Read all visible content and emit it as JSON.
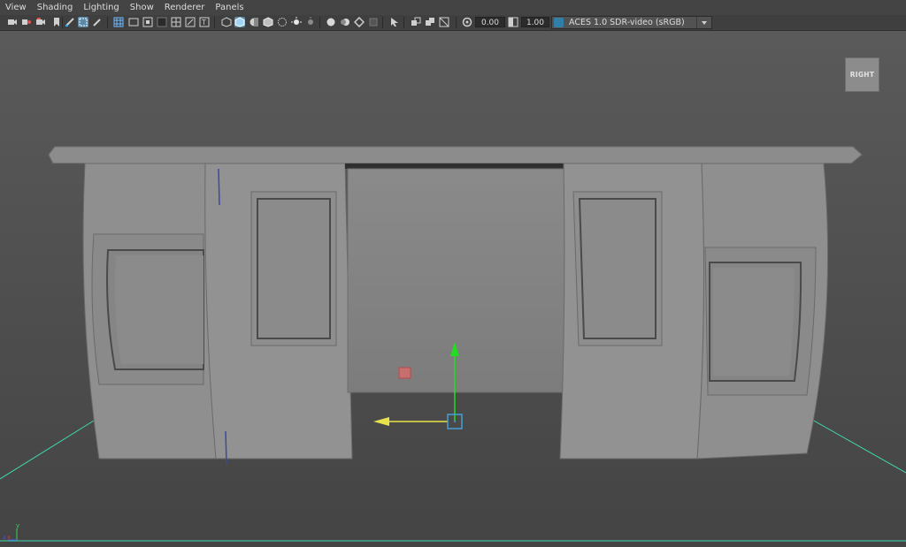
{
  "menu": [
    "View",
    "Shading",
    "Lighting",
    "Show",
    "Renderer",
    "Panels"
  ],
  "toolbar": {
    "exposure_value": "0.00",
    "gamma_value": "1.00",
    "color_management_label": "ACES 1.0 SDR-video (sRGB)"
  },
  "viewport": {
    "view_label": "RIGHT",
    "axis": {
      "x": "x",
      "y": "y",
      "z": "z"
    }
  },
  "icons": [
    "camera-select-icon",
    "camera-attributes-icon",
    "bookmark-icon",
    "image-plane-icon",
    "grease-pencil-icon",
    "2d-pan-zoom-icon",
    "grid-icon",
    "film-gate-icon",
    "resolution-gate-icon",
    "gate-mask-icon",
    "field-chart-icon",
    "safe-action-icon",
    "safe-title-icon",
    "wireframe-icon",
    "smooth-shade-icon",
    "default-material-icon",
    "wireframe-on-shaded-icon",
    "xray-icon",
    "lights-icon",
    "shadows-icon",
    "ambient-occlusion-icon",
    "motion-blur-icon",
    "anti-aliasing-icon",
    "depth-of-field-icon",
    "isolate-select-icon",
    "xray-joints-icon",
    "xray-active-icon",
    "backface-icon",
    "exposure-icon",
    "gamma-icon",
    "color-management-icon"
  ],
  "colors": {
    "viewport_bg": "#565656",
    "grid_line": "#3fd9b0",
    "manipulator_y": "#22dd22",
    "manipulator_x": "#e8e34a",
    "manipulator_center": "#45a0d8",
    "pivot_marker": "#d96a6a"
  }
}
